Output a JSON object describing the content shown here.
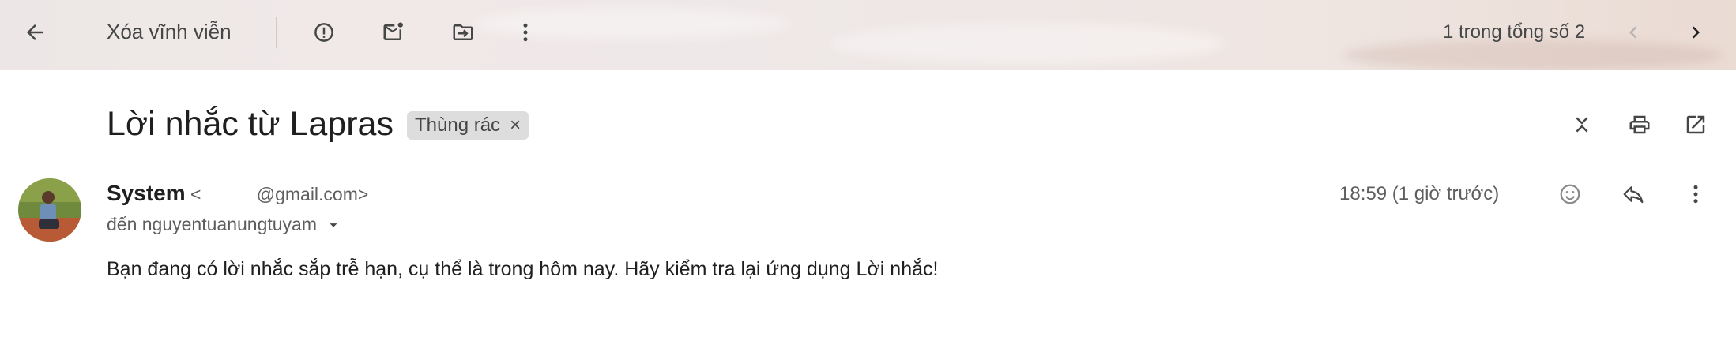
{
  "toolbar": {
    "back_icon": "arrow-left-icon",
    "delete_forever_label": "Xóa vĩnh viễn",
    "report_spam_icon": "report-icon",
    "mark_unread_icon": "mark-unread-icon",
    "move_to_icon": "move-to-folder-icon",
    "more_icon": "more-vert-icon",
    "pagination_text": "1 trong tổng số 2",
    "prev_icon": "chevron-left-icon",
    "next_icon": "chevron-right-icon"
  },
  "email": {
    "subject": "Lời nhắc từ Lapras",
    "label": "Thùng rác",
    "label_remove": "×",
    "sender_name": "System",
    "sender_email": "<           @gmail.com>",
    "recipient_text": "đến nguyentuanungtuyam",
    "timestamp": "18:59 (1 giờ trước)",
    "body": "Bạn đang có lời nhắc sắp trễ hạn, cụ thể là trong hôm nay. Hãy kiểm tra lại ứng dụng Lời nhắc!"
  },
  "colors": {
    "text_primary": "#1f1f1f",
    "text_secondary": "#5e5e5e",
    "chip_bg": "#dddddd",
    "icon": "#444746"
  }
}
